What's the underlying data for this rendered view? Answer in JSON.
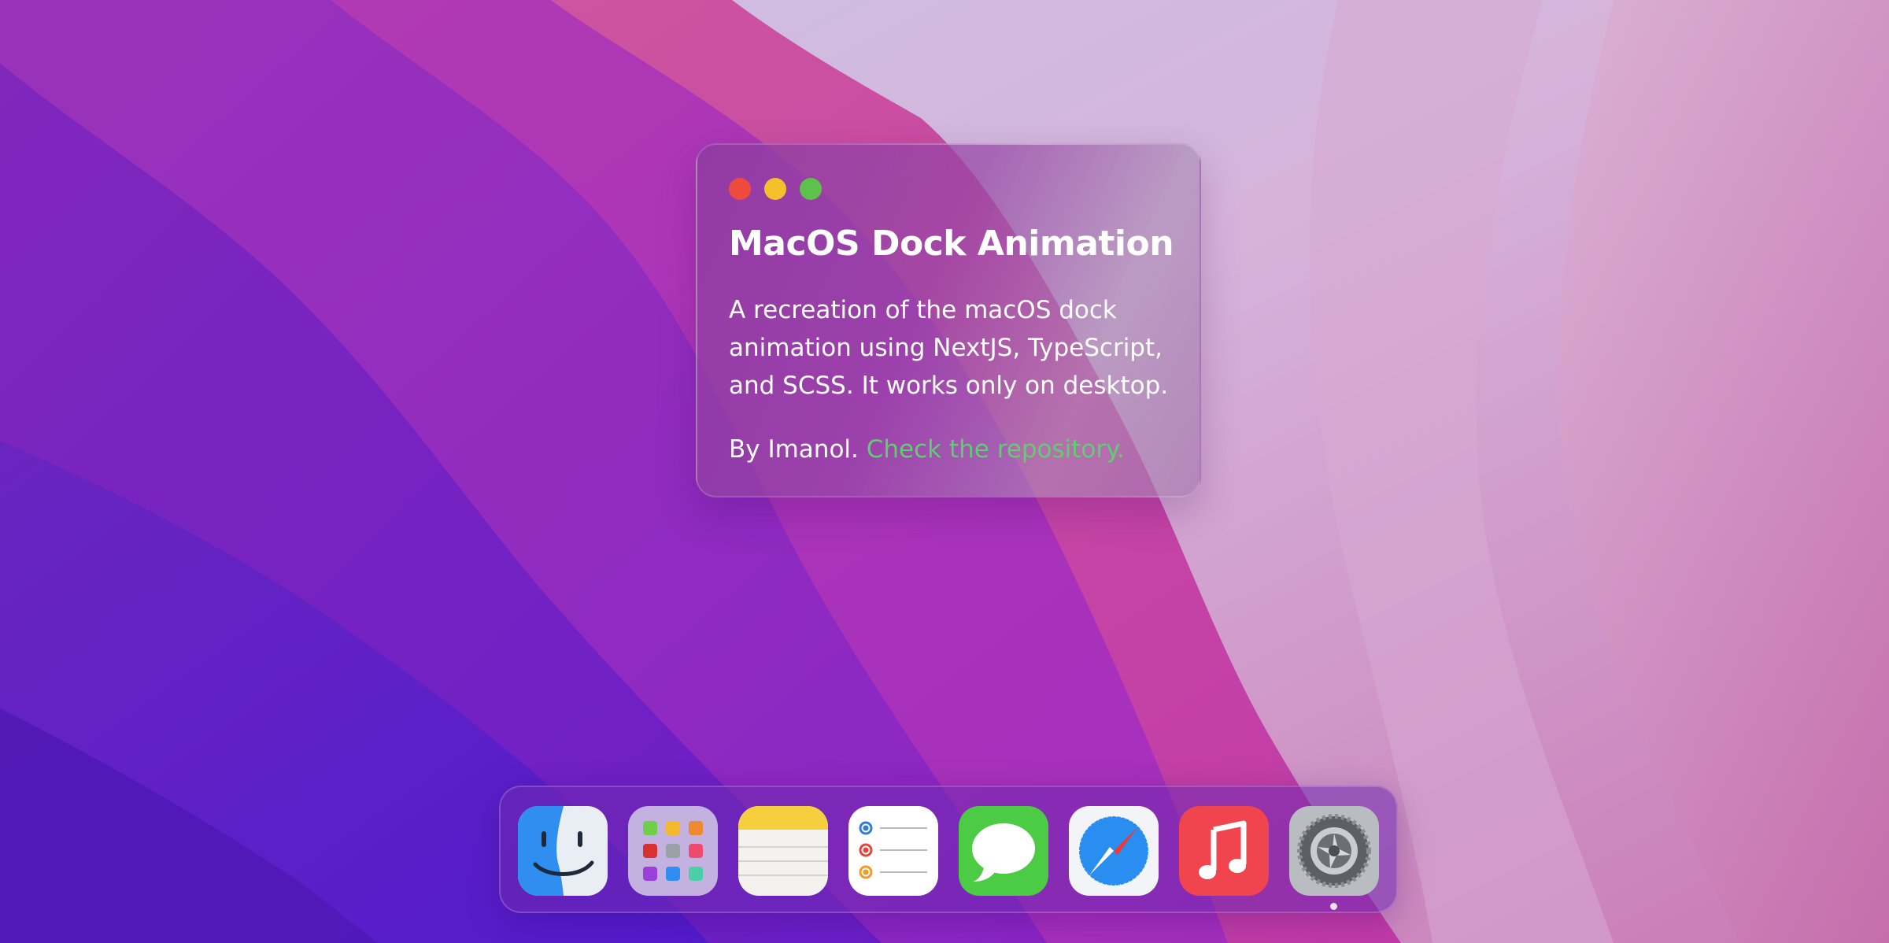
{
  "window": {
    "controls": [
      "close",
      "minimize",
      "maximize"
    ],
    "title": "MacOS Dock Animation",
    "description": "A recreation of the macOS dock animation using NextJS, TypeScript, and SCSS. It works only on desktop.",
    "byline_prefix": "By Imanol.",
    "link_text": "Check the repository.",
    "link_color": "#62cc72"
  },
  "traffic_light_colors": {
    "close": "#ee4b3e",
    "minimize": "#f5c02c",
    "maximize": "#5cc24c"
  },
  "dock": {
    "apps": [
      {
        "name": "Finder",
        "icon": "finder-icon",
        "running": false
      },
      {
        "name": "Launchpad",
        "icon": "launchpad-icon",
        "running": false
      },
      {
        "name": "Notes",
        "icon": "notes-icon",
        "running": false
      },
      {
        "name": "Reminders",
        "icon": "reminders-icon",
        "running": false
      },
      {
        "name": "Messages",
        "icon": "messages-icon",
        "running": false
      },
      {
        "name": "Safari",
        "icon": "safari-icon",
        "running": false
      },
      {
        "name": "Music",
        "icon": "music-icon",
        "running": false
      },
      {
        "name": "System Preferences",
        "icon": "system-preferences-icon",
        "running": true
      }
    ]
  },
  "wallpaper": {
    "name": "macOS Monterey",
    "colors": [
      "#5a1fc6",
      "#9b2cc0",
      "#c23aaa",
      "#d0b8dc"
    ]
  }
}
